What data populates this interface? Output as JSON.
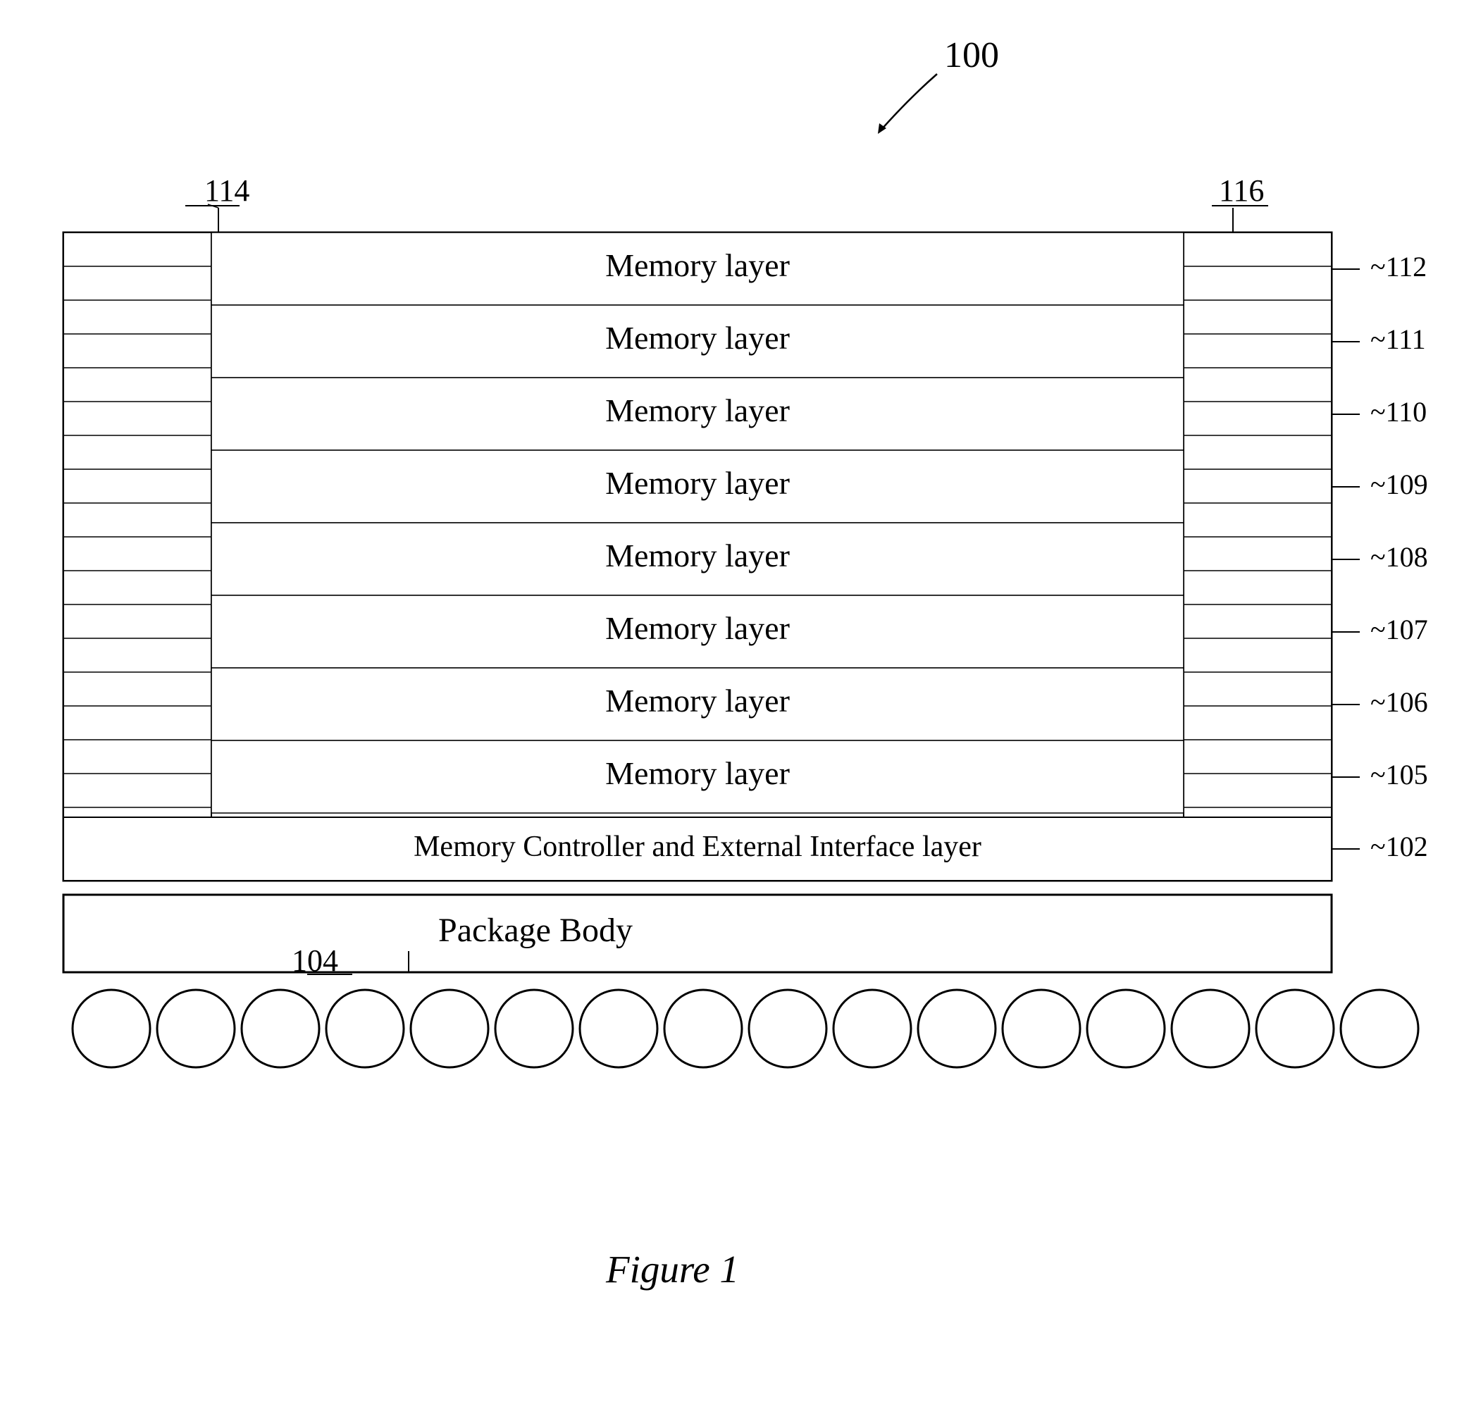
{
  "figure": {
    "title": "Figure 1",
    "reference_number": "100",
    "components": {
      "package_body": {
        "label": "Package Body",
        "ref": "104"
      },
      "controller_layer": {
        "label": "Memory Controller and External Interface layer",
        "ref": "102"
      },
      "memory_layers": [
        {
          "label": "Memory layer",
          "ref": "112"
        },
        {
          "label": "Memory layer",
          "ref": "111"
        },
        {
          "label": "Memory layer",
          "ref": "110"
        },
        {
          "label": "Memory layer",
          "ref": "109"
        },
        {
          "label": "Memory layer",
          "ref": "108"
        },
        {
          "label": "Memory layer",
          "ref": "107"
        },
        {
          "label": "Memory layer",
          "ref": "106"
        },
        {
          "label": "Memory layer",
          "ref": "105"
        }
      ],
      "left_column_ref": "114",
      "right_column_ref": "116"
    }
  }
}
